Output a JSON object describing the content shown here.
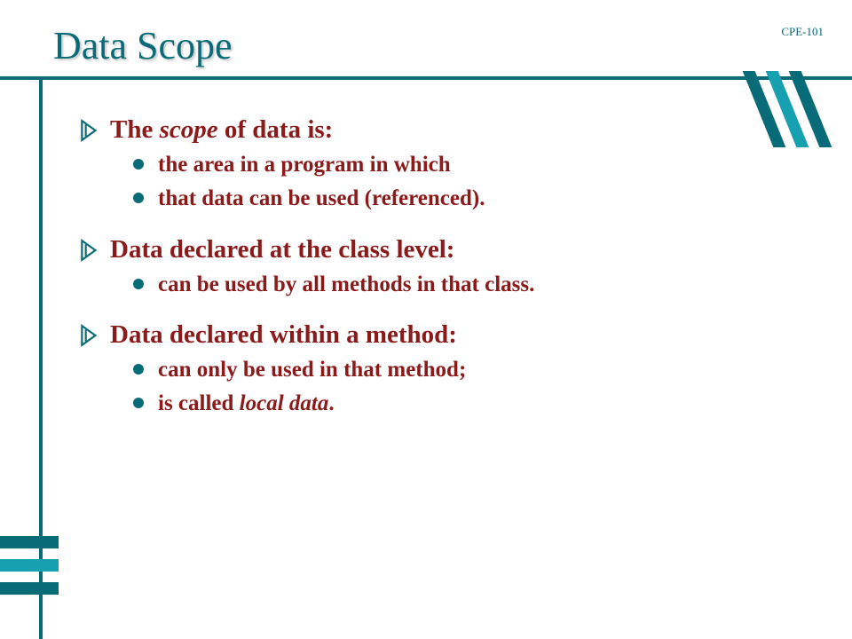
{
  "course_label": "CPE-101",
  "title": "Data Scope",
  "sections": [
    {
      "heading_parts": [
        "The ",
        "scope",
        " of data is:"
      ],
      "heading_em_index": 1,
      "bullets": [
        {
          "parts": [
            "the area in a program in which"
          ],
          "em_index": -1
        },
        {
          "parts": [
            "that data can be used (referenced)."
          ],
          "em_index": -1
        }
      ]
    },
    {
      "heading_parts": [
        "Data declared at the class level:"
      ],
      "heading_em_index": -1,
      "bullets": [
        {
          "parts": [
            "can be used by all methods in that class."
          ],
          "em_index": -1
        }
      ]
    },
    {
      "heading_parts": [
        "Data declared within a method:"
      ],
      "heading_em_index": -1,
      "bullets": [
        {
          "parts": [
            "can only be used in that method;"
          ],
          "em_index": -1
        },
        {
          "parts": [
            "is called ",
            "local data",
            "."
          ],
          "em_index": 1
        }
      ]
    }
  ]
}
